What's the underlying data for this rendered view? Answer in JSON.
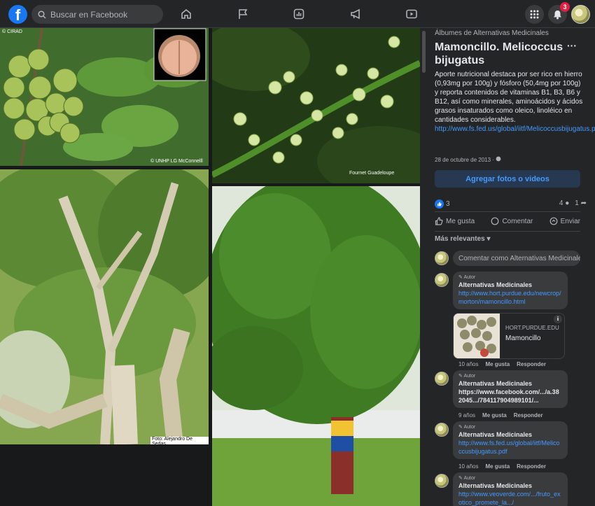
{
  "topbar": {
    "search_placeholder": "Buscar en Facebook",
    "notification_count": "3"
  },
  "photos": {
    "credit_top_left": "© CIRAD",
    "credit_top_left_bottom": "© UNHP LG McConnelll",
    "credit_top_right": "Fournet Guadeloupe",
    "credit_bottom_left": "Foto: Alejandro De Sedas"
  },
  "panel": {
    "album": "Álbumes de Alternativas Medicinales",
    "title": "Mamoncillo. Melicoccus bijugatus",
    "description": "Aporte nutricional destaca por ser rico en hierro (0,93mg por 100g) y fósforo (50,4mg por 100g) y reporta contenidos de vitaminas B1, B3, B6 y B12, así como minerales, aminoácidos y ácidos grasos insaturados como oleico, linoléico en cantidades considerables.",
    "link": "http://www.fs.fed.us/global/iitf/Melicoccusbijugatus.pdf",
    "date": "28 de octubre de 2013 ·",
    "add_button": "Agregar fotos o videos",
    "likes": "3",
    "comments_count": "4",
    "shares_count": "1",
    "actions": {
      "like": "Me gusta",
      "comment": "Comentar",
      "send": "Enviar"
    },
    "sort_label": "Más relevantes",
    "comment_placeholder": "Comentar como Alternativas Medicinales",
    "comments": [
      {
        "role": "Autor",
        "name": "Alternativas Medicinales",
        "text": "http://www.hort.purdue.edu/newcrop/morton/mamoncillo.html",
        "age": "10 años",
        "like": "Me gusta",
        "reply": "Responder"
      },
      {
        "role": "Autor",
        "name": "Alternativas Medicinales",
        "text": "https://www.facebook.com/.../a.382045.../784117904989101/...",
        "age": "9 años",
        "like": "Me gusta",
        "reply": "Responder"
      },
      {
        "role": "Autor",
        "name": "Alternativas Medicinales",
        "text": "http://www.fs.fed.us/global/iitf/Melicoccusbijugatus.pdf",
        "age": "10 años",
        "like": "Me gusta",
        "reply": "Responder"
      },
      {
        "role": "Autor",
        "name": "Alternativas Medicinales",
        "text": "http://www.veoverde.com/.../fruto_exotico_promete_la.../",
        "age": "",
        "like": "",
        "reply": ""
      }
    ],
    "link_card": {
      "domain": "HORT.PURDUE.EDU",
      "title": "Mamoncillo"
    }
  }
}
